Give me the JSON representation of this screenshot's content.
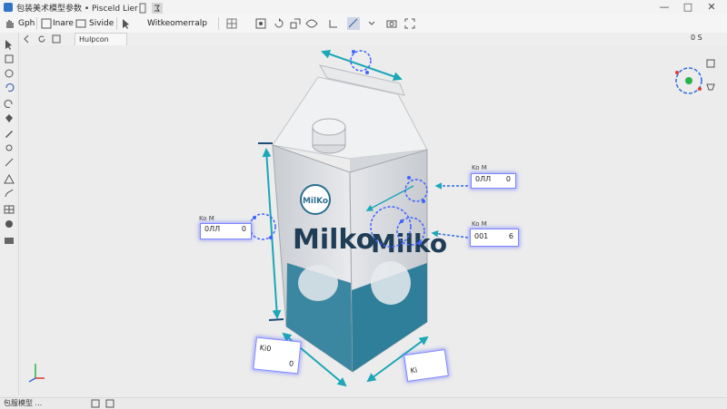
{
  "window": {
    "title": "包装美术模型参数 • Pisceld Lier",
    "controls": {
      "minimize": "—",
      "maximize": "□",
      "close": "✕"
    }
  },
  "toolbar": {
    "items": [
      "Gph",
      "Inare",
      "Sivide",
      "Witkeomerralp"
    ],
    "right_label": "0 S"
  },
  "tabs": [
    "Hulpcon"
  ],
  "viewport": {
    "product_text": "Milko",
    "logo_text": "MilKo",
    "measurements": [
      {
        "tag": "Ko M",
        "label": "0ЛЛ",
        "value": "0"
      },
      {
        "tag": "Ko M",
        "label": "0ЛЛ",
        "value": "0"
      },
      {
        "tag": "Ko M",
        "label": "001",
        "value": "6"
      },
      {
        "tag": "",
        "label": "Ki0",
        "value": "0"
      },
      {
        "tag": "",
        "label": "Ki",
        "value": ""
      }
    ]
  },
  "status": {
    "text": "包服模型 ..."
  }
}
